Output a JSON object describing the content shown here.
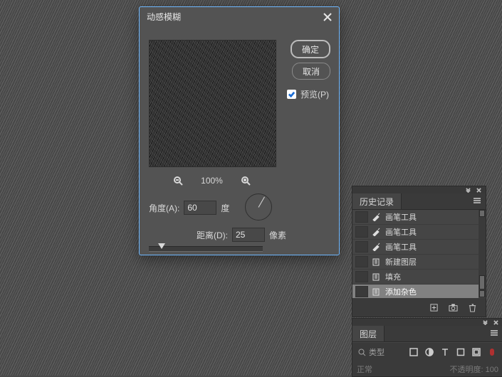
{
  "dialog": {
    "title": "动感模糊",
    "ok": "确定",
    "cancel": "取消",
    "preview_label": "预览(P)",
    "zoom": "100%",
    "angle_label": "角度(A):",
    "angle_value": "60",
    "angle_unit": "度",
    "distance_label": "距离(D):",
    "distance_value": "25",
    "distance_unit": "像素"
  },
  "history": {
    "panel_title": "历史记录",
    "items": [
      {
        "icon": "brush",
        "label": "画笔工具"
      },
      {
        "icon": "brush",
        "label": "画笔工具"
      },
      {
        "icon": "brush",
        "label": "画笔工具"
      },
      {
        "icon": "layer",
        "label": "新建图层"
      },
      {
        "icon": "layer",
        "label": "填充"
      },
      {
        "icon": "layer",
        "label": "添加杂色"
      }
    ]
  },
  "layers": {
    "panel_title": "图层",
    "search_placeholder": "类型",
    "mode": "正常",
    "opacity_label": "不透明度: 100"
  }
}
